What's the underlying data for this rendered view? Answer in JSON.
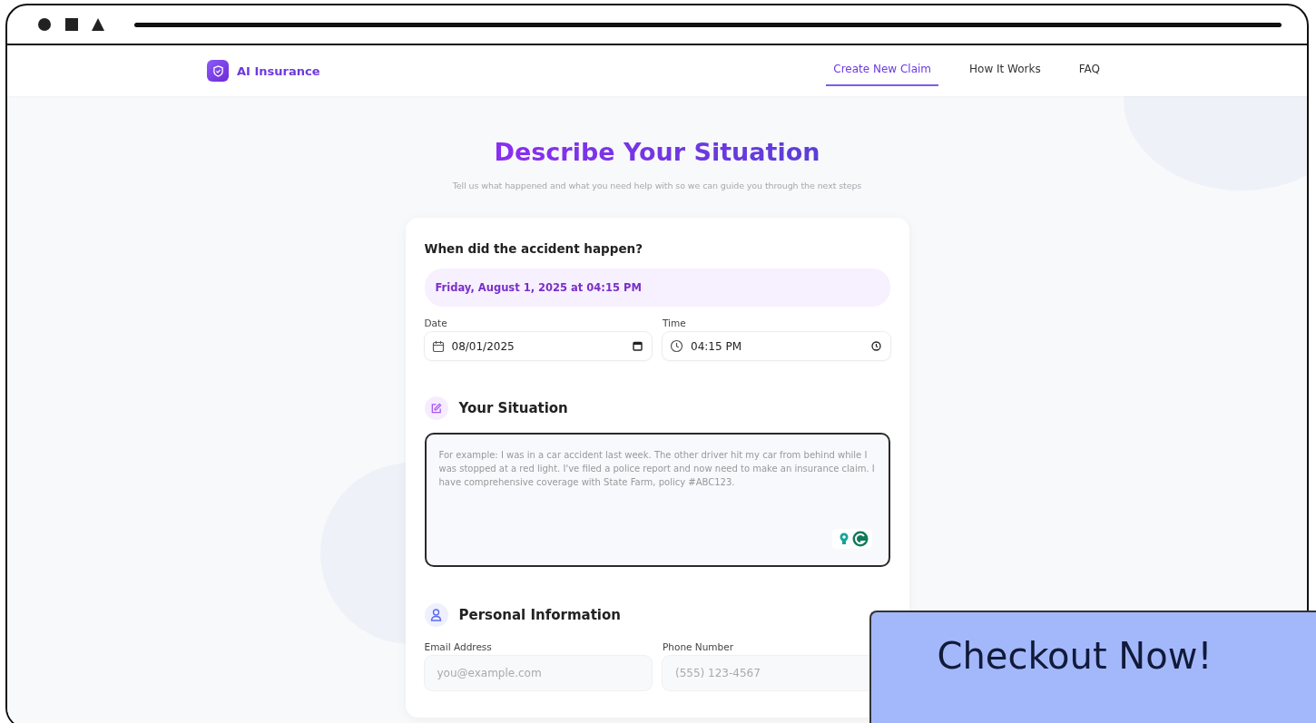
{
  "brand": {
    "name": "AI Insurance"
  },
  "nav": [
    {
      "label": "Create New Claim",
      "selected": true
    },
    {
      "label": "How It Works",
      "selected": false
    },
    {
      "label": "FAQ",
      "selected": false
    }
  ],
  "heading": {
    "title": "Describe Your Situation",
    "subtitle": "Tell us what happened and what you need help with so we can guide you through the next steps"
  },
  "when": {
    "question": "When did the accident happen?",
    "summary": "Friday, August 1, 2025 at 04:15 PM",
    "fields": [
      {
        "kind": "date",
        "label": "Date",
        "value": "08/01/2025"
      },
      {
        "kind": "time",
        "label": "Time",
        "value": "04:15 PM"
      }
    ]
  },
  "situation": {
    "title": "Your Situation",
    "placeholder": "For example: I was in a car accident last week. The other driver hit my car from behind while I was stopped at a red light. I've filed a police report and now need to make an insurance claim. I have comprehensive coverage with State Farm, policy #ABC123."
  },
  "personal": {
    "title": "Personal Information",
    "fields": [
      {
        "label": "Email Address",
        "placeholder": "you@example.com"
      },
      {
        "label": "Phone Number",
        "placeholder": "(555) 123-4567"
      }
    ]
  },
  "overlay": {
    "label": "Checkout Now!"
  }
}
